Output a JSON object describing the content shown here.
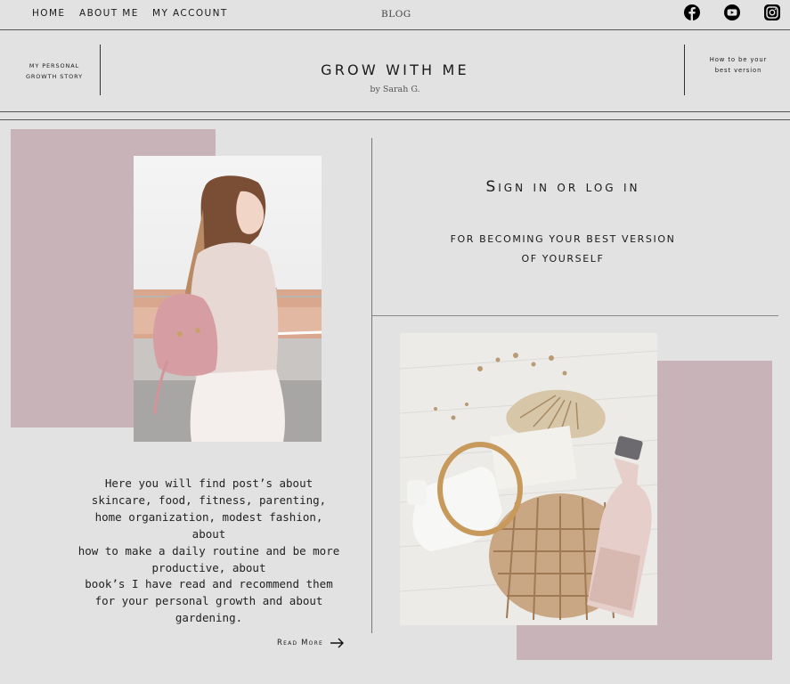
{
  "nav": {
    "items": [
      {
        "label": "HOME"
      },
      {
        "label": "ABOUT ME"
      },
      {
        "label": "MY ACCOUNT"
      }
    ],
    "blog_label": "BLOG",
    "social": [
      "facebook-icon",
      "youtube-icon",
      "instagram-icon"
    ]
  },
  "header": {
    "left_link": "MY PERSONAL GROWTH STORY",
    "title": "GROW WITH ME",
    "byline": "by Sarah G.",
    "right_link": "How to be your best version"
  },
  "intro": {
    "text": "Here you will find post’s about skincare, food, fitness, parenting, home organization, modest fashion, about\nhow to make a daily routine and be more productive, about\nbook’s I have read and recommend them for your personal growth and about gardening.",
    "read_more": "Read More"
  },
  "signin": {
    "title": "Sign in or log in",
    "subtitle_line1": "FOR BECOMING YOUR BEST VERSION",
    "subtitle_line2": "OF YOURSELF"
  },
  "colors": {
    "background": "#e2e2e2",
    "accent_pink": "#c7b3b8",
    "text": "#1a1a1a"
  }
}
